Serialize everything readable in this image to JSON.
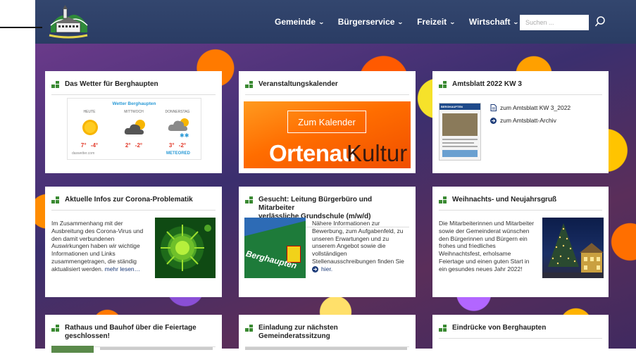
{
  "header": {
    "nav": [
      {
        "label": "Gemeinde"
      },
      {
        "label": "Bürgerservice"
      },
      {
        "label": "Freizeit"
      },
      {
        "label": "Wirtschaft"
      }
    ],
    "search_placeholder": "Suchen ...",
    "chevron": "⌄"
  },
  "cards": {
    "weather": {
      "title": "Das Wetter für Berghaupten",
      "widget_title": "Wetter Berghaupten",
      "days": [
        {
          "day": "HEUTE",
          "high": "7°",
          "low": "-4°",
          "icon": "sun-icon"
        },
        {
          "day": "MITTWOCH",
          "high": "2°",
          "low": "-2°",
          "icon": "cloud-sun-icon"
        },
        {
          "day": "DONNERSTAG",
          "high": "3°",
          "low": "-2°",
          "icon": "cloud-snow-icon"
        }
      ],
      "source": "daswetter.com",
      "brand": "METEORED"
    },
    "calendar": {
      "title": "Veranstaltungskalender",
      "button": "Zum Kalender",
      "brand_bold": "Ortenau",
      "brand_light": "Kultur"
    },
    "amtsblatt": {
      "title": "Amtsblatt 2022 KW 3",
      "thumb_header": "BERGHAUPTEN",
      "link1": "zum Amtsblatt KW 3_2022",
      "link2": "zum Amtsblatt-Archiv"
    },
    "corona": {
      "title": "Aktuelle Infos zur Corona-Problematik",
      "lines": [
        "Im Zusammenhang mit der",
        "Ausbreitung des Corona-Virus und",
        "den damit verbundenen",
        "Auswirkungen haben wir wichtige",
        "Informationen und Links",
        "zusammengetragen, die ständig"
      ],
      "last_line": "aktualisiert werden.",
      "more": "mehr lesen…"
    },
    "gesucht": {
      "title_line1": "Gesucht: Leitung Bürgerbüro und Mitarbeiter",
      "title_line2": "verlässliche Grundschule (m/w/d)",
      "lines": [
        "Nähere Informationen zur",
        "Bewerbung, zum Aufgabenfeld, zu",
        "unseren Erwartungen und zu",
        "unserem Angebot sowie die",
        "vollständigen",
        "Stellenausschreibungen finden Sie"
      ],
      "link": "hier.",
      "image_text": "Berghaupten"
    },
    "weihnacht": {
      "title": "Weihnachts- und Neujahrsgruß",
      "lines": [
        "Die Mitarbeiterinnen und Mitarbeiter",
        "sowie der Gemeinderat wünschen",
        "den Bürgerinnen und Bürgern ein",
        "frohes und friedliches",
        "Weihnachtsfest, erholsame",
        "Feiertage und einen guten Start in",
        "ein gesundes neues Jahr 2022!"
      ]
    },
    "rathaus": {
      "title_line1": "Rathaus und Bauhof über die Feiertage",
      "title_line2": "geschlossen!"
    },
    "einladung": {
      "title": "Einladung zur nächsten Gemeinderatssitzung"
    },
    "eindruecke": {
      "title": "Eindrücke von Berghaupten"
    }
  },
  "colors": {
    "header": "#2e4169",
    "accent_green": "#3a8a32",
    "link": "#1b3a78",
    "orange": "#ff6d00"
  }
}
